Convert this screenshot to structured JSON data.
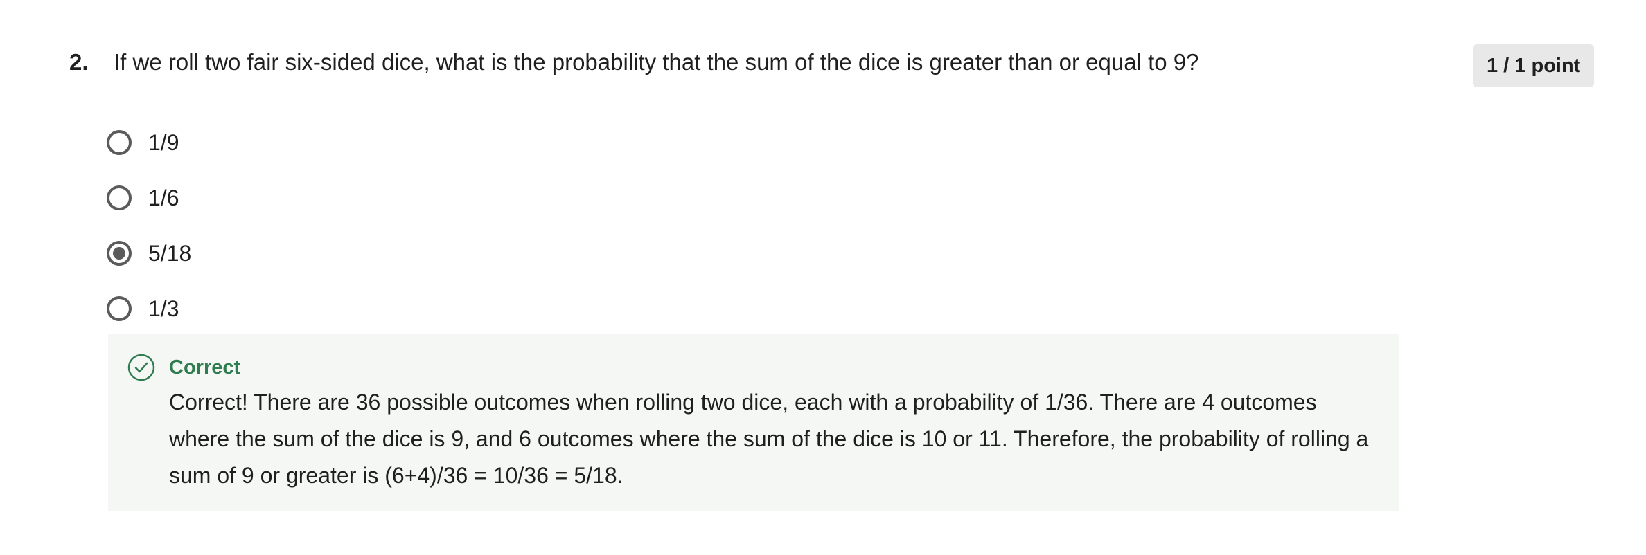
{
  "question": {
    "number": "2.",
    "text": "If we roll two fair six-sided dice, what is the probability that the sum of the dice is greater than or equal to 9?",
    "points": "1 / 1 point"
  },
  "options": [
    {
      "label": "1/9",
      "selected": false
    },
    {
      "label": "1/6",
      "selected": false
    },
    {
      "label": "5/18",
      "selected": true
    },
    {
      "label": "1/3",
      "selected": false
    }
  ],
  "feedback": {
    "title": "Correct",
    "icon": "check-circle-icon",
    "text": "Correct! There are 36 possible outcomes when rolling two dice, each with a probability of 1/36. There are 4 outcomes where the sum of the dice is 9, and 6 outcomes where the sum of the dice is 10 or 11. Therefore, the probability of rolling a sum of 9 or greater is (6+4)/36 = 10/36 = 5/18.",
    "color": "#2e7c4f"
  }
}
